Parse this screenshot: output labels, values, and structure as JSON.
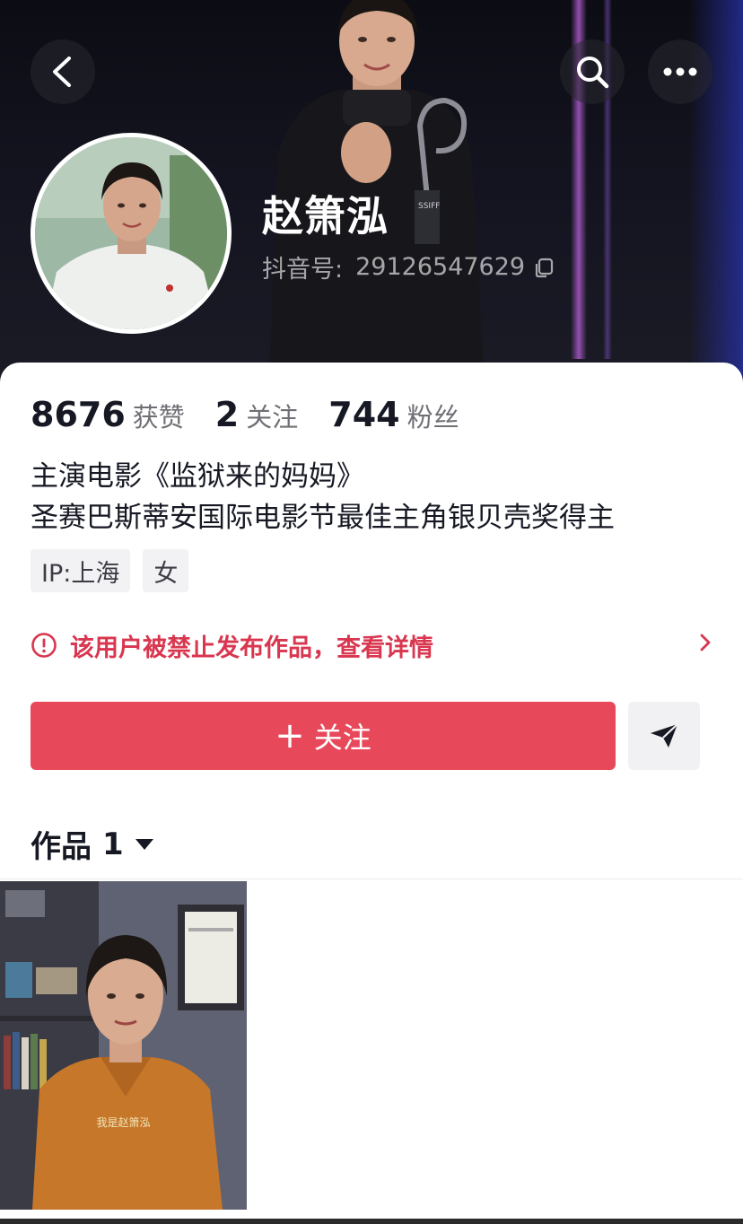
{
  "profile": {
    "display_name": "赵箫泓",
    "account_id_label": "抖音号:",
    "account_id": "29126547629"
  },
  "stats": [
    {
      "value": "8676",
      "label": "获赞"
    },
    {
      "value": "2",
      "label": "关注"
    },
    {
      "value": "744",
      "label": "粉丝"
    }
  ],
  "bio": {
    "line1": "主演电影《监狱来的妈妈》",
    "line2": "圣赛巴斯蒂安国际电影节最佳主角银贝壳奖得主"
  },
  "tags": [
    "IP:上海",
    "女"
  ],
  "notice": {
    "text": "该用户被禁止发布作品，查看详情",
    "color": "#d9364f"
  },
  "actions": {
    "follow_plus": "+",
    "follow_label": "关注",
    "follow_color": "#e8495a"
  },
  "works": {
    "label": "作品",
    "count": "1"
  },
  "video": {
    "caption": "我是赵箫泓"
  },
  "icons": [
    "back-arrow-icon",
    "search-icon",
    "more-icon",
    "copy-icon",
    "warning-icon",
    "chevron-right-icon",
    "send-icon",
    "caret-down-icon"
  ]
}
